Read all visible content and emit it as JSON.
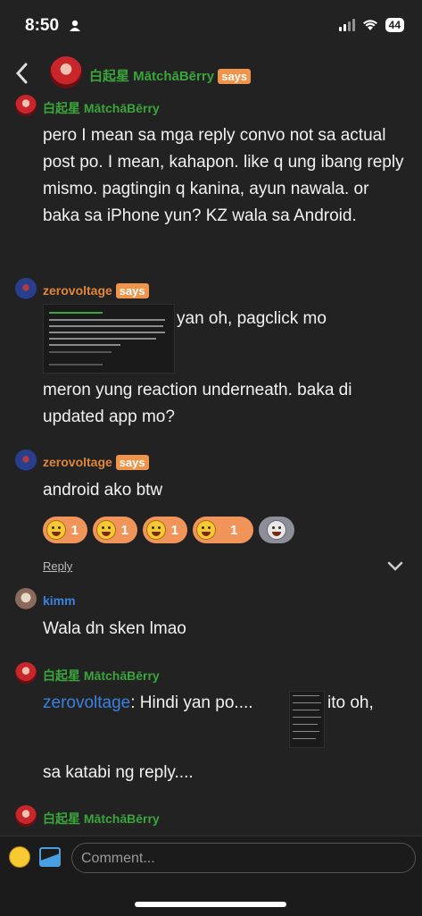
{
  "status_bar": {
    "time": "8:50",
    "battery": "44"
  },
  "header": {
    "name": "白起星 MātchāBērry",
    "says": "says"
  },
  "posts": [
    {
      "author": "白起星 MātchāBērry",
      "text": "pero I mean sa mga reply convo not sa actual post po. I mean, kahapon. like q ung ibang reply mismo. pagtingin q kanina, ayun nawala. or baka sa iPhone yun? KZ wala sa Android."
    },
    {
      "author": "zerovoltage",
      "says": "says",
      "text_inline": "yan oh, pagclick mo",
      "text_after": "meron yung reaction underneath. baka di updated app mo?"
    },
    {
      "author": "zerovoltage",
      "says": "says",
      "text": "android ako btw",
      "reactions": [
        {
          "emoji": "laughing-face",
          "count": "1"
        },
        {
          "emoji": "grinning-face",
          "count": "1"
        },
        {
          "emoji": "winking-face",
          "count": "1"
        },
        {
          "emoji": "surprised-face",
          "count": "1"
        }
      ],
      "reply_label": "Reply"
    },
    {
      "author": "kimm",
      "text": "Wala dn sken lmao"
    },
    {
      "author": "白起星 MātchāBērry",
      "mention": "zerovoltage",
      "text_a": ": Hindi yan po....",
      "text_b": "ito oh,",
      "text_c": "sa katabi ng reply...."
    },
    {
      "author": "白起星 MātchāBērry"
    }
  ],
  "footer": {
    "placeholder": "Comment..."
  }
}
